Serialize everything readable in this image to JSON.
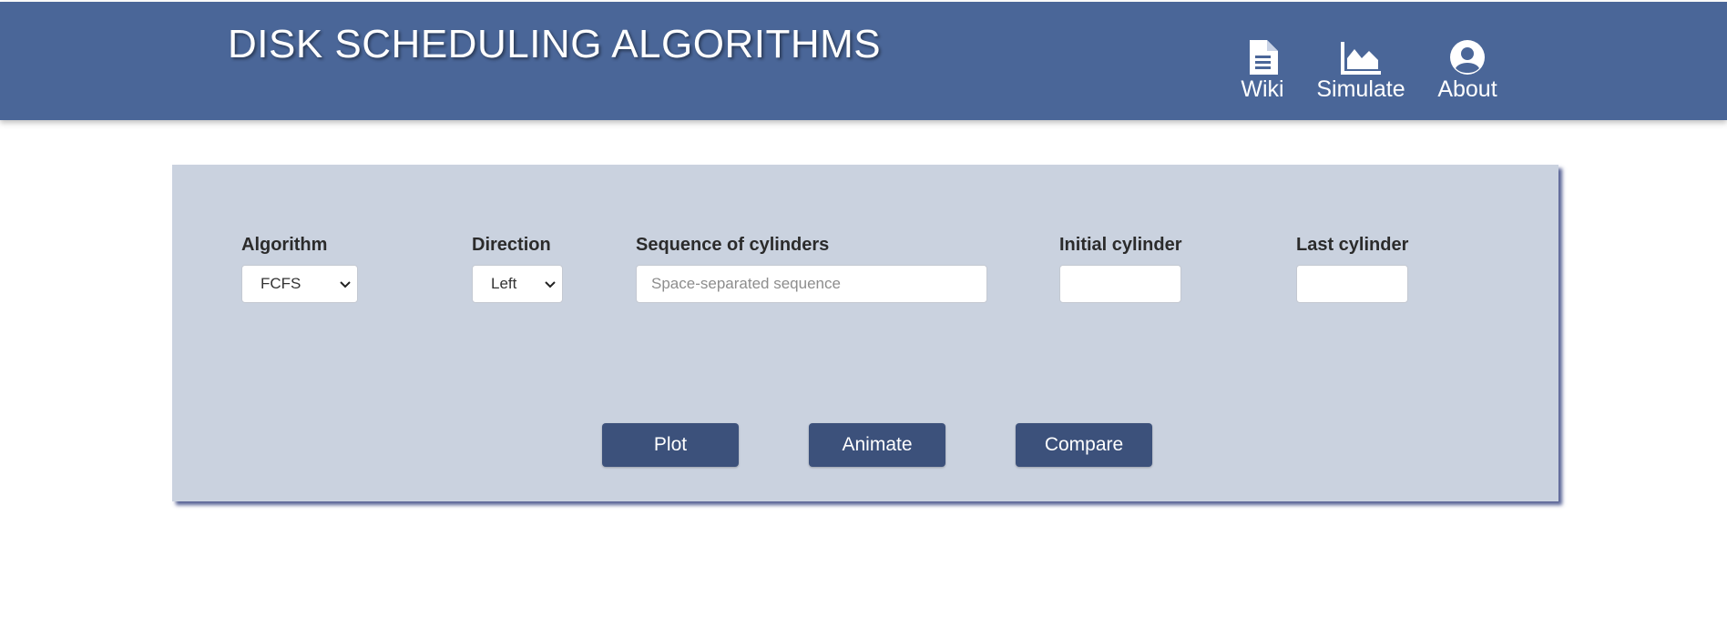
{
  "header": {
    "title": "DISK SCHEDULING ALGORITHMS",
    "nav": [
      {
        "label": "Wiki",
        "icon": "document-icon"
      },
      {
        "label": "Simulate",
        "icon": "area-chart-icon"
      },
      {
        "label": "About",
        "icon": "user-circle-icon"
      }
    ]
  },
  "form": {
    "algorithm": {
      "label": "Algorithm",
      "value": "FCFS"
    },
    "direction": {
      "label": "Direction",
      "value": "Left"
    },
    "sequence": {
      "label": "Sequence of cylinders",
      "value": "",
      "placeholder": "Space-separated sequence"
    },
    "initial": {
      "label": "Initial cylinder",
      "value": ""
    },
    "last": {
      "label": "Last cylinder",
      "value": ""
    }
  },
  "actions": {
    "plot": "Plot",
    "animate": "Animate",
    "compare": "Compare"
  },
  "colors": {
    "header_bg": "#4a6698",
    "panel_bg": "#cad2df",
    "button_bg": "#3c517b"
  }
}
